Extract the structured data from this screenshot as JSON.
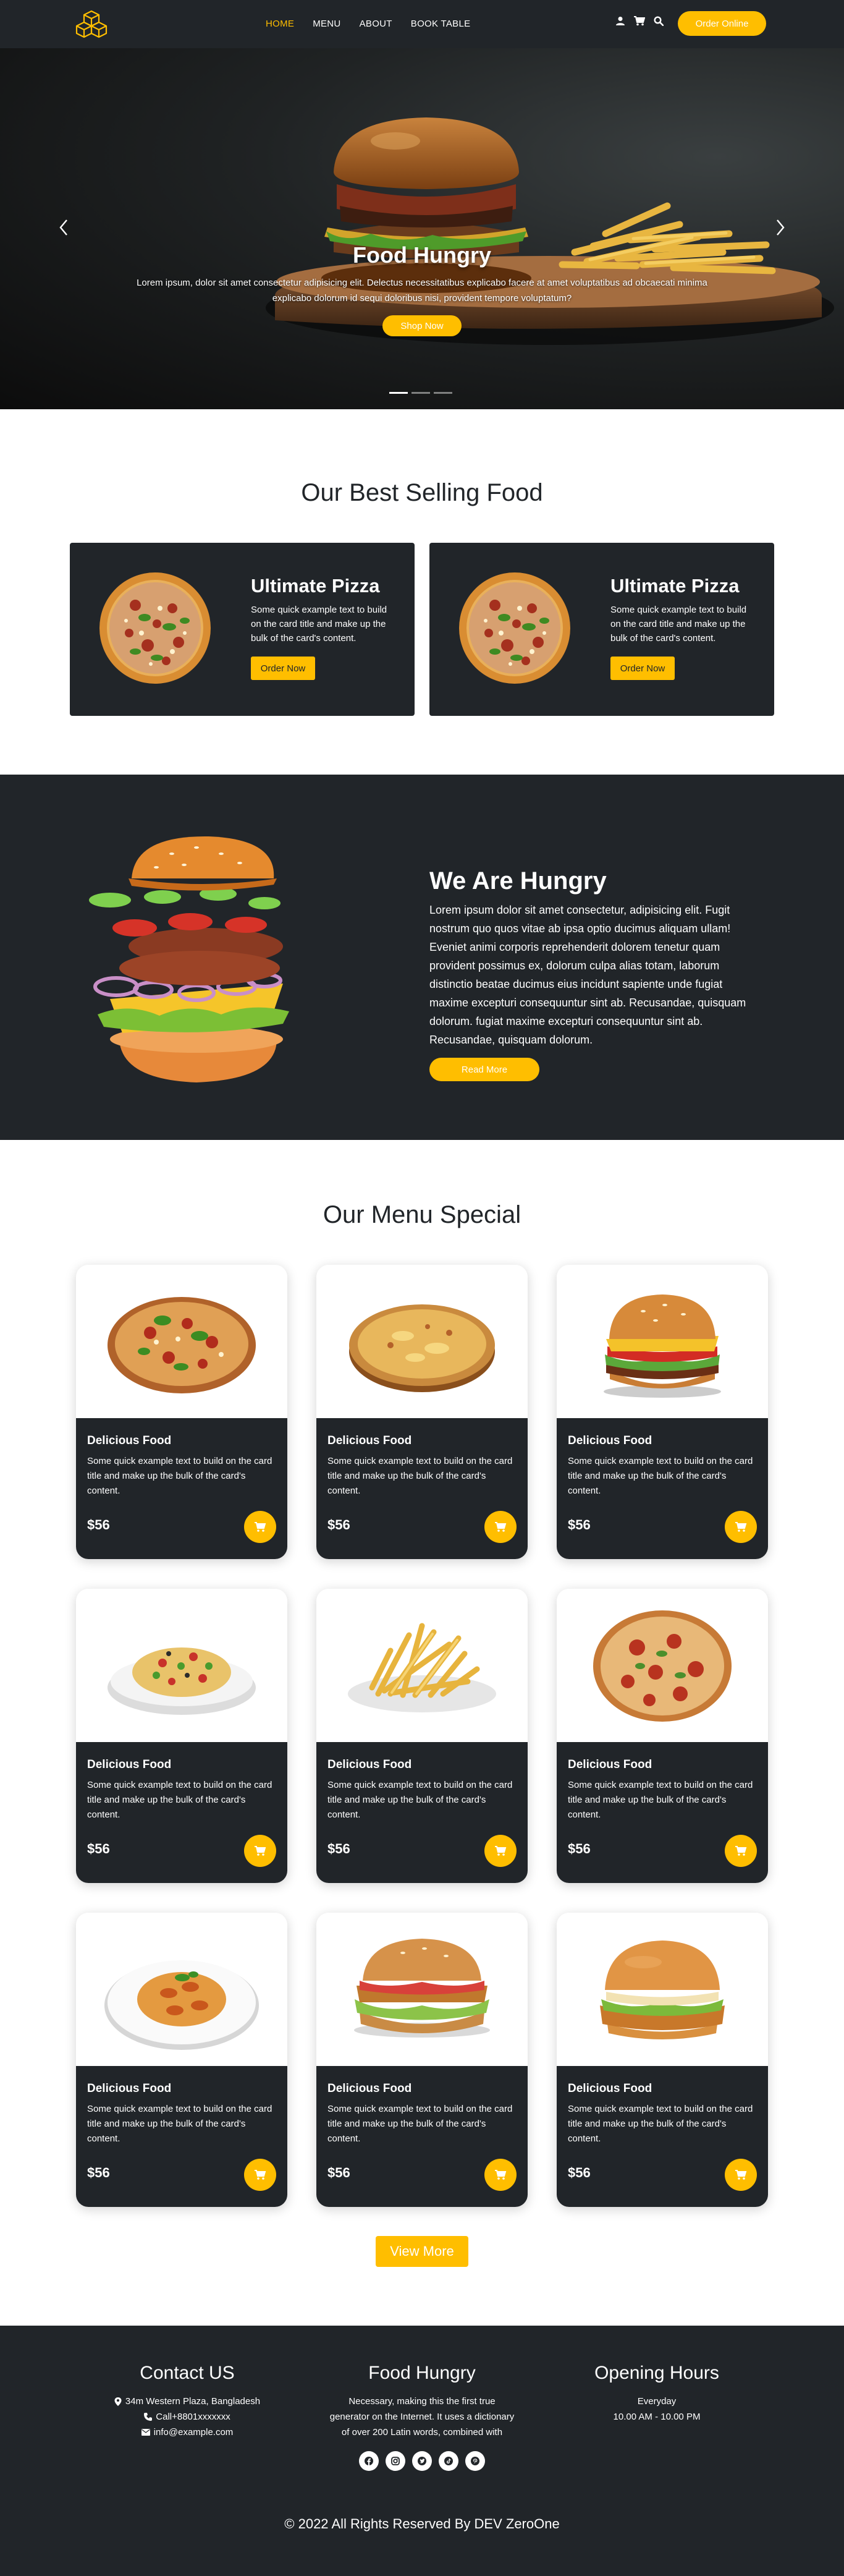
{
  "nav": {
    "logo_icon": "cubes-logo-icon",
    "items": [
      {
        "label": "HOME",
        "active": true
      },
      {
        "label": "MENU",
        "active": false
      },
      {
        "label": "ABOUT",
        "active": false
      },
      {
        "label": "BOOK TABLE",
        "active": false
      }
    ],
    "icons": [
      "user-icon",
      "cart-icon",
      "search-icon"
    ],
    "order_label": "Order Online"
  },
  "colors": {
    "accent": "#ffbe00",
    "dark": "#212529",
    "light": "#ffffff"
  },
  "hero": {
    "title": "Food Hungry",
    "text": "Lorem ipsum, dolor sit amet consectetur adipisicing elit. Delectus necessitatibus explicabo facere at amet voluptatibus ad obcaecati minima explicabo dolorum id sequi doloribus nisi, provident tempore voluptatum?",
    "button": "Shop Now",
    "slide_count": 3,
    "active_slide": 1
  },
  "best_selling": {
    "title": "Our Best Selling Food",
    "cards": [
      {
        "title": "Ultimate Pizza",
        "text": "Some quick example text to build on the card title and make up the bulk of the card's content.",
        "button": "Order Now"
      },
      {
        "title": "Ultimate Pizza",
        "text": "Some quick example text to build on the card title and make up the bulk of the card's content.",
        "button": "Order Now"
      }
    ]
  },
  "about": {
    "title": "We Are Hungry",
    "text": "Lorem ipsum dolor sit amet consectetur, adipisicing elit. Fugit nostrum quo quos vitae ab ipsa optio ducimus aliquam ullam! Eveniet animi corporis reprehenderit dolorem tenetur quam provident possimus ex, dolorum culpa alias totam, laborum distinctio beatae ducimus eius incidunt sapiente unde fugiat maxime excepturi consequuntur sint ab. Recusandae, quisquam dolorum. fugiat maxime excepturi consequuntur sint ab. Recusandae, quisquam dolorum.",
    "button": "Read More"
  },
  "menu_special": {
    "title": "Our Menu Special",
    "items": [
      {
        "image": "pizza-supreme",
        "title": "Delicious Food",
        "text": "Some quick example text to build on the card title and make up the bulk of the card's content.",
        "price": "$56"
      },
      {
        "image": "pizza-cheese",
        "title": "Delicious Food",
        "text": "Some quick example text to build on the card title and make up the bulk of the card's content.",
        "price": "$56"
      },
      {
        "image": "burger",
        "title": "Delicious Food",
        "text": "Some quick example text to build on the card title and make up the bulk of the card's content.",
        "price": "$56"
      },
      {
        "image": "pasta-salad",
        "title": "Delicious Food",
        "text": "Some quick example text to build on the card title and make up the bulk of the card's content.",
        "price": "$56"
      },
      {
        "image": "french-fries",
        "title": "Delicious Food",
        "text": "Some quick example text to build on the card title and make up the bulk of the card's content.",
        "price": "$56"
      },
      {
        "image": "pizza-pepperoni",
        "title": "Delicious Food",
        "text": "Some quick example text to build on the card title and make up the bulk of the card's content.",
        "price": "$56"
      },
      {
        "image": "pasta-plate",
        "title": "Delicious Food",
        "text": "Some quick example text to build on the card title and make up the bulk of the card's content.",
        "price": "$56"
      },
      {
        "image": "chicken-sandwich",
        "title": "Delicious Food",
        "text": "Some quick example text to build on the card title and make up the bulk of the card's content.",
        "price": "$56"
      },
      {
        "image": "crispy-chicken-burger",
        "title": "Delicious Food",
        "text": "Some quick example text to build on the card title and make up the bulk of the card's content.",
        "price": "$56"
      }
    ],
    "view_more": "View More"
  },
  "footer": {
    "contact": {
      "title": "Contact US",
      "address": "34m Western Plaza, Bangladesh",
      "phone": "Call+8801xxxxxxx",
      "email": "info@example.com"
    },
    "brand": {
      "title": "Food Hungry",
      "text": "Necessary, making this the first true generator on the Internet. It uses a dictionary of over 200 Latin words, combined with",
      "socials": [
        "facebook-icon",
        "instagram-icon",
        "twitter-icon",
        "tiktok-icon",
        "pinterest-icon"
      ]
    },
    "hours": {
      "title": "Opening Hours",
      "days": "Everyday",
      "time": "10.00 AM - 10.00 PM"
    },
    "copyright": "© 2022 All Rights Reserved By DEV ZeroOne"
  }
}
